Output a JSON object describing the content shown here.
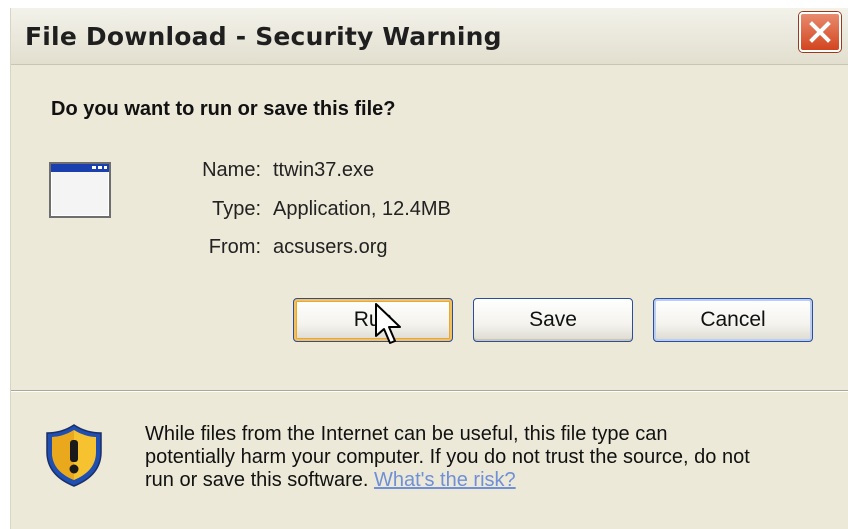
{
  "dialog": {
    "title": "File Download - Security Warning",
    "question": "Do you want to run or save this file?"
  },
  "file": {
    "name_label": "Name:",
    "name_value": "ttwin37.exe",
    "type_label": "Type:",
    "type_value": "Application, 12.4MB",
    "from_label": "From:",
    "from_value": "acsusers.org"
  },
  "buttons": {
    "run": "Run",
    "save": "Save",
    "cancel": "Cancel"
  },
  "warning": {
    "line1": "While files from the Internet can be useful, this file type can",
    "line2": "potentially harm your computer. If you do not trust the source, do not",
    "line3": "run or save this software.",
    "link": "What's the risk?"
  },
  "icons": {
    "close": "close-icon",
    "application": "application-window-icon",
    "shield": "warning-shield-icon",
    "cursor": "mouse-cursor-icon"
  },
  "colors": {
    "close_button": "#d2451f",
    "link": "#6f8fd7",
    "focus_ring": "#e7a83a",
    "dialog_background": "#ece9d8"
  }
}
